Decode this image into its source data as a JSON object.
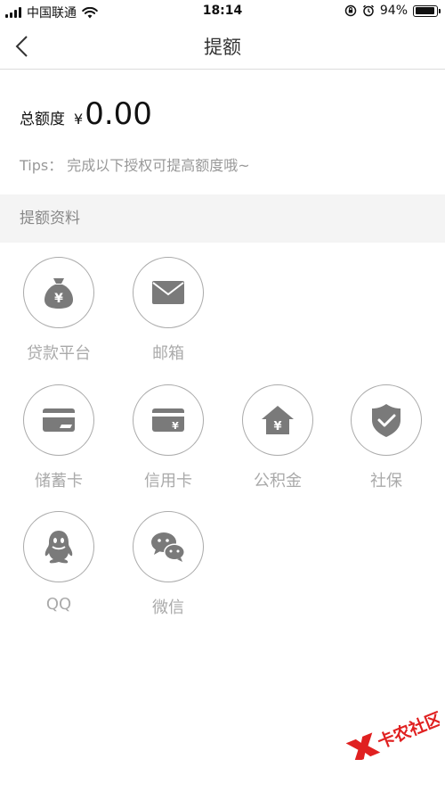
{
  "status_bar": {
    "carrier": "中国联通",
    "time": "18:14",
    "battery": "94%",
    "battery_level": 0.94
  },
  "nav": {
    "title": "提额"
  },
  "amount": {
    "label": "总额度",
    "currency": "¥",
    "value": "0.00"
  },
  "tips": "Tips： 完成以下授权可提高额度哦~",
  "section": {
    "title": "提额资料"
  },
  "items": [
    {
      "label": "贷款平台",
      "icon": "money-bag-icon"
    },
    {
      "label": "邮箱",
      "icon": "envelope-icon"
    },
    {
      "label": "储蓄卡",
      "icon": "debit-card-icon"
    },
    {
      "label": "信用卡",
      "icon": "credit-card-icon"
    },
    {
      "label": "公积金",
      "icon": "house-fund-icon"
    },
    {
      "label": "社保",
      "icon": "shield-check-icon"
    },
    {
      "label": "QQ",
      "icon": "qq-penguin-icon"
    },
    {
      "label": "微信",
      "icon": "wechat-icon"
    }
  ],
  "watermark": {
    "text": "卡农社区"
  },
  "colors": {
    "icon_gray": "#7a7a7a",
    "label_gray": "#aaaaaa",
    "section_bg": "#f4f4f4"
  }
}
